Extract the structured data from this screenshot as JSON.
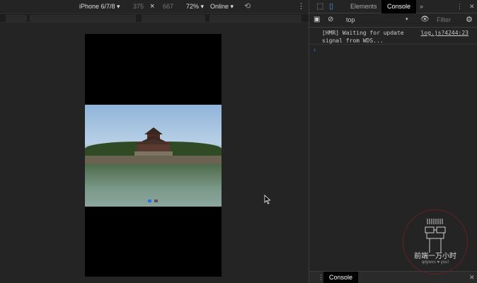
{
  "device_toolbar": {
    "device": "iPhone 6/7/8",
    "width": "375",
    "times": "×",
    "height": "667",
    "zoom": "72%",
    "network": "Online"
  },
  "carousel": {
    "slide_count": 2,
    "active_index": 0,
    "accent": "#2d6fe0"
  },
  "devtools": {
    "tabs": [
      "Elements",
      "Console"
    ],
    "active_tab": "Console",
    "more": "»",
    "context": "top",
    "filter_placeholder": "Filter",
    "log_message_line1": "[HMR] Waiting for update",
    "log_message_line2": "signal from WDS...",
    "log_source": "log.js?4244:23",
    "prompt": "›",
    "drawer_tab": "Console"
  },
  "watermark": {
    "title": "前端一万小时",
    "subtitle": "qdywxs ♥ you!"
  }
}
